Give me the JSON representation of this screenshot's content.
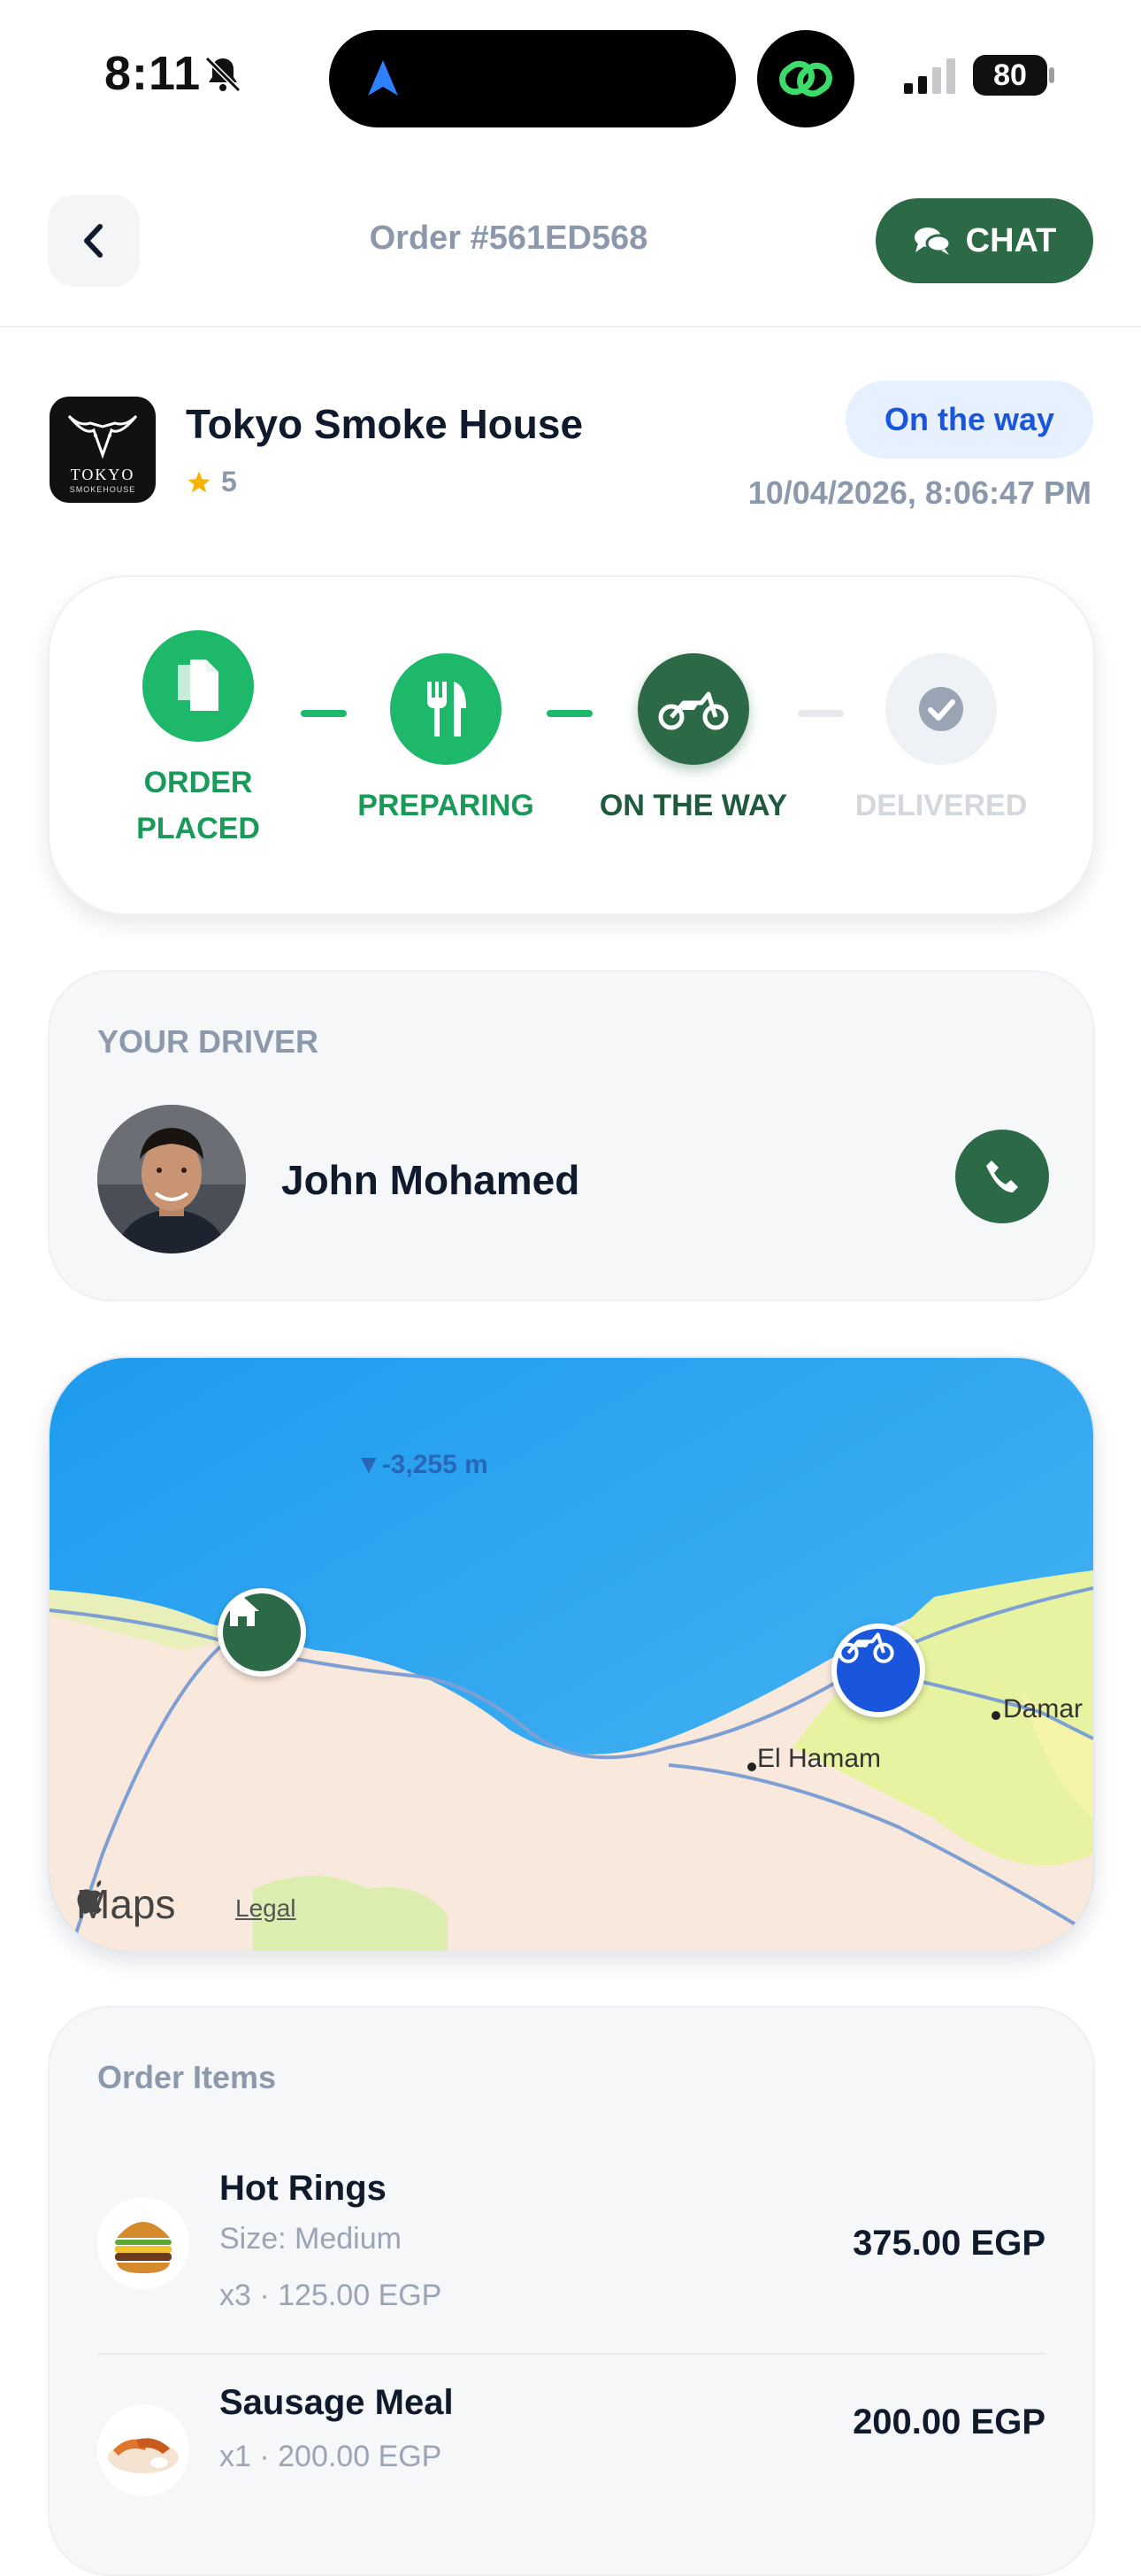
{
  "status_bar": {
    "time": "8:11",
    "battery": "80"
  },
  "header": {
    "order_title": "Order #561ED568",
    "chat_label": "CHAT"
  },
  "restaurant": {
    "name": "Tokyo Smoke House",
    "rating": "5",
    "logo_text_1": "TOKYO",
    "logo_text_2": "SMOKEHOUSE",
    "status": "On the way",
    "timestamp": "10/04/2026, 8:06:47 PM"
  },
  "progress": {
    "steps": [
      {
        "label_line1": "ORDER",
        "label_line2": "PLACED",
        "state": "done"
      },
      {
        "label_line1": "PREPARING",
        "label_line2": "",
        "state": "done"
      },
      {
        "label_line1": "ON THE WAY",
        "label_line2": "",
        "state": "current"
      },
      {
        "label_line1": "DELIVERED",
        "label_line2": "",
        "state": "pending"
      }
    ]
  },
  "driver": {
    "caption": "YOUR DRIVER",
    "name": "John Mohamed"
  },
  "map": {
    "depth_label": "▼-3,255 m",
    "place_1": "El Hamam",
    "place_2": "Damar",
    "maps_label": "Maps",
    "legal_label": "Legal"
  },
  "order_items": {
    "caption": "Order Items",
    "items": [
      {
        "name": "Hot Rings",
        "size": "Size: Medium",
        "qty_price": "x3 · 125.00 EGP",
        "total": "375.00 EGP"
      },
      {
        "name": "Sausage Meal",
        "size": "",
        "qty_price": "x1 · 200.00 EGP",
        "total": "200.00 EGP"
      }
    ]
  },
  "colors": {
    "brand_green": "#2c6a47",
    "step_green": "#1db86a",
    "accent_blue": "#1a56db",
    "muted": "#8c99ad"
  }
}
